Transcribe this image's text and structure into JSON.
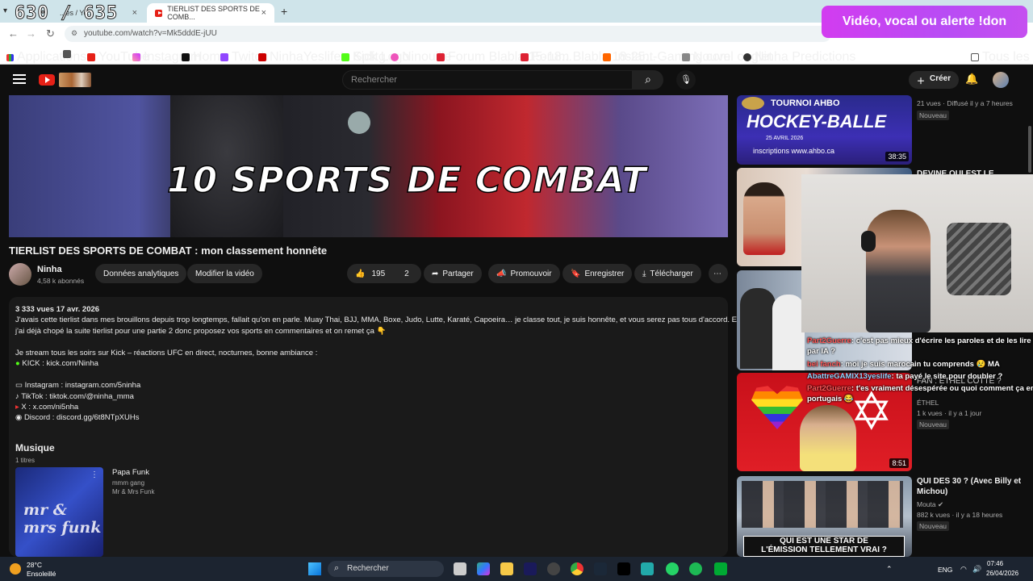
{
  "stream_overlay": {
    "counter": "630 / 635",
    "donate_banner": "Vidéo, vocal ou alerte !don"
  },
  "browser": {
    "tabs": [
      {
        "label": "...es / Yo..."
      },
      {
        "label": "TIERLIST DES SPORTS DE COMB..."
      }
    ],
    "new_tab": "+",
    "close": "×",
    "url": "youtube.com/watch?v=Mk5dddE-jUU",
    "bookmarks": [
      "Applications",
      "YouTube",
      "Instagram",
      "Home",
      "Twitch",
      "NinhaYeslife's Splitg...",
      "Kick Logo",
      "Ninouille",
      "Forum Blabla 15-18...",
      "Forum Blabla 18-25...",
      "Instant-Gaming.com",
      "Nouvel onglet",
      "Ninha Predictions"
    ],
    "all_bookmarks": "Tous les favoris"
  },
  "youtube": {
    "search_placeholder": "Rechercher",
    "create_label": "Créer",
    "video_overlay_text": "10 SPORTS DE COMBAT",
    "video_title": "TIERLIST DES SPORTS DE COMBAT : mon classement honnête",
    "channel_name": "Ninha",
    "subscribers": "4,58 k abonnés",
    "analytics_button": "Données analytiques",
    "edit_button": "Modifier la vidéo",
    "likes": "195",
    "dislikes": "2",
    "share": "Partager",
    "promote": "Promouvoir",
    "save": "Enregistrer",
    "download": "Télécharger",
    "description": {
      "stats": "3 333 vues  17 avr. 2026",
      "line1": "J'avais cette tierlist dans mes brouillons depuis trop longtemps, fallait qu'on en parle. Muay Thai, BJJ, MMA, Boxe, Judo, Lutte, Karaté, Capoeira… je classe tout, je suis honnête, et vous serez pas tous d'accord. Et",
      "line2": "j'ai déjà chopé la suite tierlist pour une partie 2 donc proposez vos sports en commentaires et on remet ça 👇",
      "line3": "Je stream tous les soirs sur Kick – réactions UFC en direct, nocturnes, bonne ambiance :",
      "kick": "KICK : kick.com/Ninha",
      "instagram": "Instagram : instagram.com/5ninha",
      "tiktok": "TikTok : tiktok.com/@ninha_mma",
      "x": "X : x.com/ni5nha",
      "discord": "Discord : discord.gg/6t8NTpXUHs",
      "music_heading": "Musique",
      "music_count": "1 titres",
      "song_title": "Papa Funk",
      "song_artist": "mmm gang",
      "song_album": "Mr & Mrs Funk",
      "album_art_text": "mr & mrs funk"
    },
    "sidebar": [
      {
        "title": "",
        "meta1": "21 vues · Diffusé il y a 7 heures",
        "meta2": "Nouveau",
        "duration": "38:35",
        "thumb_text1": "TOURNOI AHBO",
        "thumb_text2": "HOCKEY-BALLE",
        "thumb_text3": "25 AVRIL 2026",
        "thumb_text4": "inscriptions www.ahbo.ca"
      },
      {
        "title": "DEVINE QUI EST LE",
        "meta1": "",
        "meta2": "",
        "duration": ""
      },
      {
        "title": "ÉTHEL",
        "meta1": "1 k vues · il y a 1 jour",
        "meta2": "Nouveau",
        "duration": "8:51",
        "title_line": "FAN : ÉTHEL COTTÉ ?"
      },
      {
        "title": "QUI DES 30 ? (Avec Billy et",
        "title2": "Michou)",
        "channel": "Mouta ✔",
        "meta1": "882 k vues · il y a 18 heures",
        "meta2": "Nouveau",
        "thumb_text1": "QUI EST UNE STAR DE",
        "thumb_text2": "L'ÉMISSION TELLEMENT VRAI ?"
      }
    ]
  },
  "chat": [
    {
      "user": "Part2Guerre",
      "msg": ": c'est pas mieux d'écrire les paroles et de les lire",
      "msg2": "par IA ?"
    },
    {
      "user": "bei fanch",
      "msg": ": moi je suis marocain tu comprends 😢 MA"
    },
    {
      "user": "AbattreGAMIX13yeslife",
      "msg": ": ta payé le site pour doubler ?"
    },
    {
      "user": "Part2Guerre",
      "msg": ": t'es vraiment désespérée ou quoi comment ça en",
      "msg2": "portugais 😂"
    }
  ],
  "taskbar": {
    "weather_temp": "28°C",
    "weather_desc": "Ensoleillé",
    "search": "Rechercher",
    "lang": "ENG",
    "time": "07:46",
    "date": "26/04/2026"
  },
  "colors": {
    "youtube_red": "#e62117",
    "donate_purple": "#c54ff0",
    "dark_bg": "#0f0f0f"
  }
}
